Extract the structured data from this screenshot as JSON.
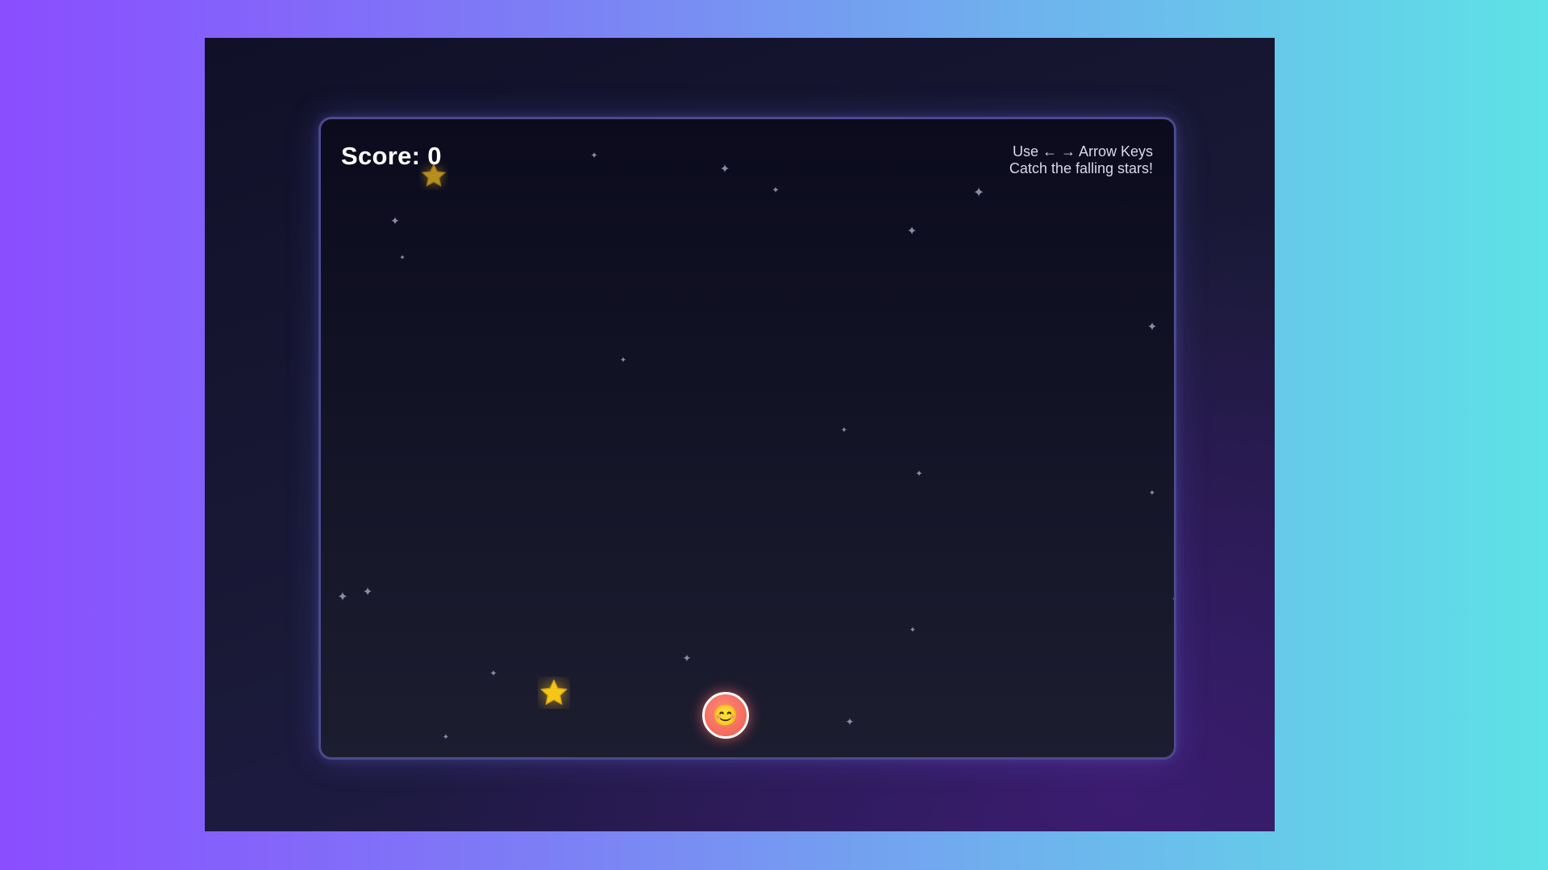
{
  "game": {
    "score_label": "Score: 0",
    "score": 0,
    "instructions": {
      "line1": "Use ← → Arrow Keys",
      "line2": "Catch the falling stars!"
    },
    "player": {
      "glyph": "😊",
      "icon": "smiley-face-icon",
      "color": "#f26a5c"
    },
    "falling_stars": [
      {
        "icon": "falling-star-icon",
        "color": "#f0c020"
      },
      {
        "icon": "falling-star-icon",
        "color": "#f5c518"
      }
    ],
    "background_sparkle": {
      "icon": "sparkle-icon",
      "glyph": "✦"
    },
    "colors": {
      "page_gradient_start": "#8a4dff",
      "page_gradient_end": "#5de2e6",
      "frame": "#1a1a38",
      "game_border": "#4a4a8c",
      "score_text": "#ffffff",
      "star": "#f5c518"
    }
  }
}
